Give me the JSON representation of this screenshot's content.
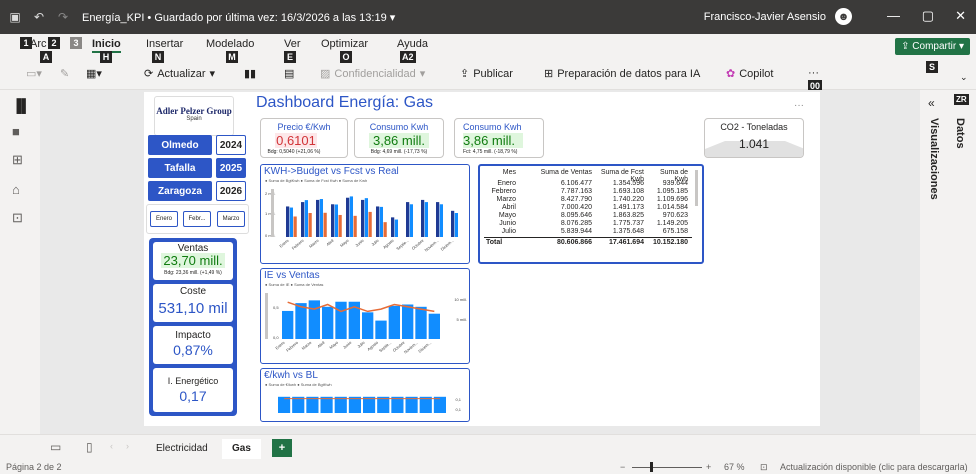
{
  "titlebar": {
    "title": "Energía_KPI • Guardado por última vez: 16/3/2026 a las 13:19 ▾",
    "user": "Francisco-Javier Asensio",
    "save_icon": "save-icon",
    "undo_icon": "undo-icon",
    "redo_icon": "redo-icon"
  },
  "ribbon": {
    "tabs": [
      "Inicio",
      "Insertar",
      "Modelado",
      "Ver",
      "Optimizar",
      "Ayuda"
    ],
    "keytips": {
      "file": "A",
      "home": "H",
      "insert": "N",
      "model": "M",
      "view": "E",
      "optimize": "O",
      "help": "A2",
      "share": "S",
      "more": "00",
      "k1": "1",
      "k2": "2",
      "k3": "3"
    },
    "file_label": "Arc",
    "buttons": {
      "refresh": "Actualizar",
      "sensitivity": "Confidencialidad",
      "publish": "Publicar",
      "prep": "Preparación de datos para IA",
      "copilot": "Copilot",
      "more": "···"
    },
    "share": "Compartir"
  },
  "rightpane": {
    "visualizations": "Visualizaciones",
    "data": "Datos",
    "badge": "ZR",
    "collapse": "«"
  },
  "report": {
    "logo_name": "Adler Pelzer Group",
    "logo_sub": "Spain",
    "title": "Dashboard Energía: Gas",
    "plants": [
      "Olmedo",
      "Tafalla",
      "Zaragoza"
    ],
    "years": [
      "2024",
      "2025",
      "2026"
    ],
    "months": [
      "Enero",
      "Febr...",
      "Marzo"
    ],
    "kpis": {
      "price": {
        "title": "Precio €/Kwh",
        "value": "0,6101",
        "sub": "Bdg: 0,5040 (+21,06 %)"
      },
      "consumo": {
        "title": "Consumo Kwh",
        "value": "3,86 mill.",
        "sub": "Bdg: 4,69 mill. (-17,73 %)"
      },
      "consumo2": {
        "title": "Consumo Kwh",
        "value": "3,86 mill.",
        "sub": "Fct: 4,75 mill. (-18,79 %)"
      },
      "co2": {
        "title": "CO2 - Toneladas",
        "value": "1.041"
      }
    },
    "side": {
      "ventas_lbl": "Ventas",
      "ventas_val": "23,70 mill.",
      "ventas_sub": "Bdg: 23,36 mill. (+1,49 %)",
      "coste_lbl": "Coste",
      "coste_val": "531,10 mil",
      "impacto_lbl": "Impacto",
      "impacto_val": "0,87%",
      "energ_lbl": "I. Energético",
      "energ_val": "0,17"
    },
    "charts": {
      "c1_title": "KWH->Budget vs Fcst vs Real",
      "c1_legend": "● Suma de BgtKwh ● Suma de Fcst Kwh ● Suma de Kwh",
      "c1_ylabels": [
        "2 mill.",
        "1 mill.",
        "0 mill."
      ],
      "c2_title": "IE vs Ventas",
      "c2_legend": "● Suma de IE ● Suma de Ventas",
      "c2_ylabels": [
        "0,5",
        "0,0"
      ],
      "c2_y2labels": [
        "10 mill.",
        "5 mill."
      ],
      "c3_title": "€/kwh vs BL",
      "c3_legend": "● Suma de €/kwh ● Suma de BgtKwh",
      "c3_ylabels": [
        "0,1",
        "0,1"
      ],
      "months": [
        "Enero",
        "Febrero",
        "Marzo",
        "Abril",
        "Mayo",
        "Junio",
        "Julio",
        "Agosto",
        "Septie...",
        "Octubre",
        "Noviem...",
        "Diciem..."
      ]
    },
    "table": {
      "headers": [
        "Mes",
        "Suma de Ventas",
        "Suma de Fcst Kwh",
        "Suma de Kwh"
      ],
      "rows": [
        [
          "Enero",
          "6.106.477",
          "1.354.596",
          "939.644"
        ],
        [
          "Febrero",
          "7.787.163",
          "1.693.108",
          "1.095.185"
        ],
        [
          "Marzo",
          "8.427.790",
          "1.740.220",
          "1.109.696"
        ],
        [
          "Abril",
          "7.000.420",
          "1.491.173",
          "1.014.584"
        ],
        [
          "Mayo",
          "8.095.646",
          "1.863.825",
          "970.623"
        ],
        [
          "Junio",
          "8.076.285",
          "1.775.737",
          "1.149.205"
        ],
        [
          "Julio",
          "5.839.944",
          "1.375.648",
          "675.158"
        ]
      ],
      "total": [
        "Total",
        "80.606.866",
        "17.461.694",
        "10.152.180"
      ]
    }
  },
  "pages": {
    "tabs": [
      "Electricidad",
      "Gas"
    ],
    "add": "+"
  },
  "status": {
    "page": "Página 2 de 2",
    "zoom": "67 %",
    "update": "Actualización disponible (clic para descargarla)"
  },
  "chart_data": [
    {
      "type": "bar",
      "title": "KWH->Budget vs Fcst vs Real",
      "categories": [
        "Enero",
        "Febrero",
        "Marzo",
        "Abril",
        "Mayo",
        "Junio",
        "Julio",
        "Agosto",
        "Septie...",
        "Octubre",
        "Noviem...",
        "Diciem..."
      ],
      "series": [
        {
          "name": "Suma de BgtKwh",
          "values": [
            1.4,
            1.6,
            1.7,
            1.5,
            1.8,
            1.7,
            1.4,
            0.9,
            1.6,
            1.7,
            1.6,
            1.2
          ]
        },
        {
          "name": "Suma de Fcst Kwh",
          "values": [
            1.35,
            1.69,
            1.74,
            1.49,
            1.86,
            1.78,
            1.38,
            0.8,
            1.5,
            1.6,
            1.5,
            1.1
          ]
        },
        {
          "name": "Suma de Kwh",
          "values": [
            0.94,
            1.1,
            1.11,
            1.01,
            0.97,
            1.15,
            0.68,
            0,
            0,
            0,
            0,
            0
          ]
        }
      ],
      "ylim": [
        0,
        2.2
      ]
    },
    {
      "type": "bar",
      "title": "IE vs Ventas",
      "categories": [
        "Enero",
        "Febrero",
        "Marzo",
        "Abril",
        "Mayo",
        "Junio",
        "Julio",
        "Agosto",
        "Septie...",
        "Octubre",
        "Noviem...",
        "Diciem..."
      ],
      "series": [
        {
          "name": "Suma de IE",
          "values": [
            0.16,
            0.14,
            0.13,
            0.15,
            0.12,
            0.14,
            0.12,
            0.13,
            0.15,
            0.14,
            0.13,
            0.12
          ]
        },
        {
          "name": "Suma de Ventas",
          "values": [
            6.1,
            7.8,
            8.4,
            7.0,
            8.1,
            8.1,
            5.8,
            4.0,
            7.2,
            7.5,
            7.0,
            5.5
          ]
        }
      ]
    },
    {
      "type": "bar",
      "title": "€/kwh vs BL",
      "categories": [
        "Enero",
        "Febrero",
        "Marzo",
        "Abril",
        "Mayo",
        "Junio",
        "Julio",
        "Agosto",
        "Septie...",
        "Octubre",
        "Noviem...",
        "Diciem..."
      ],
      "series": [
        {
          "name": "Suma de €/kwh",
          "values": [
            0.09,
            0.09,
            0.09,
            0.09,
            0.09,
            0.09,
            0.09,
            0.09,
            0.09,
            0.09,
            0.09,
            0.09
          ]
        },
        {
          "name": "Suma de BgtKwh",
          "values": [
            0.08,
            0.08,
            0.08,
            0.08,
            0.08,
            0.08,
            0.08,
            0.08,
            0.08,
            0.08,
            0.08,
            0.08
          ]
        }
      ]
    }
  ]
}
